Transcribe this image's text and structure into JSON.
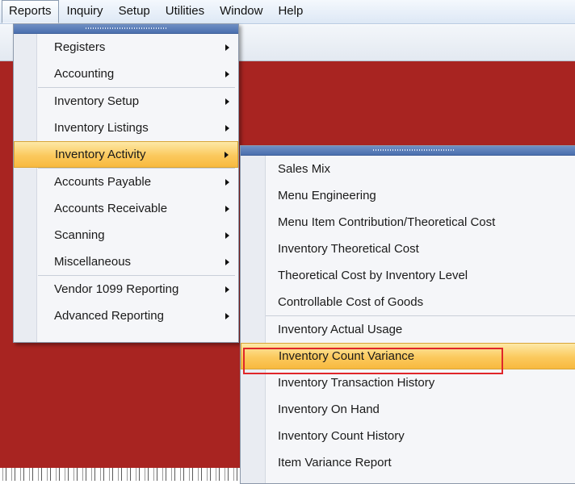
{
  "menubar": {
    "items": [
      "Reports",
      "Inquiry",
      "Setup",
      "Utilities",
      "Window",
      "Help"
    ]
  },
  "reports_menu": {
    "groups": [
      [
        "Registers",
        "Accounting"
      ],
      [
        "Inventory Setup",
        "Inventory Listings",
        "Inventory Activity"
      ],
      [
        "Accounts Payable",
        "Accounts Receivable",
        "Scanning",
        "Miscellaneous"
      ],
      [
        "Vendor 1099 Reporting",
        "Advanced Reporting"
      ]
    ],
    "highlighted": "Inventory Activity"
  },
  "inventory_activity_menu": {
    "groups": [
      [
        "Sales Mix",
        "Menu Engineering",
        "Menu Item Contribution/Theoretical Cost",
        "Inventory Theoretical Cost",
        "Theoretical Cost by Inventory Level",
        "Controllable Cost of Goods"
      ],
      [
        "Inventory Actual Usage",
        "Inventory Count Variance",
        "Inventory Transaction History",
        "Inventory On Hand",
        "Inventory Count History",
        "Item Variance Report"
      ]
    ],
    "highlighted": "Inventory Count Variance"
  },
  "colors": {
    "workspace": "#a82421",
    "highlight": "#fbc95d",
    "outline": "#e0262a"
  }
}
